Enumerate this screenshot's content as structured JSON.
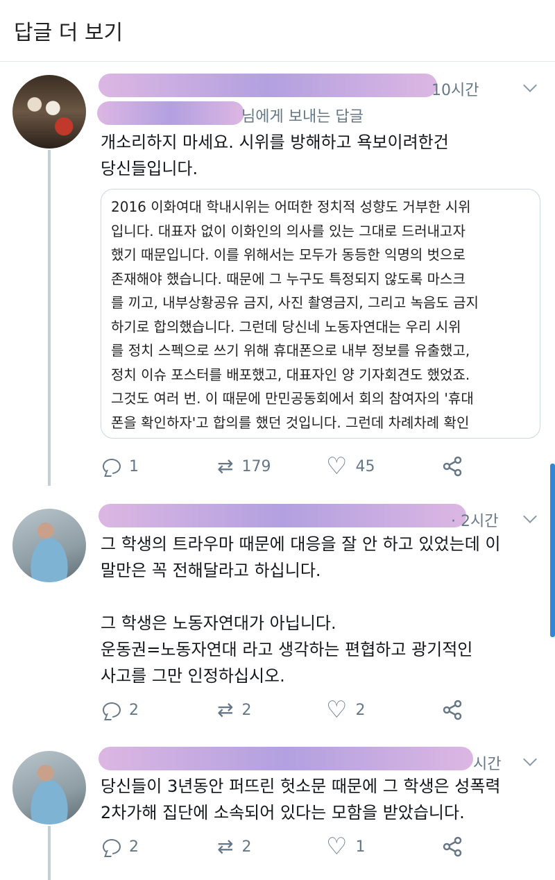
{
  "header": {
    "title": "답글 더 보기"
  },
  "tweets": [
    {
      "time": "10시간",
      "reply_to_suffix": "님에게 보내는 답글",
      "text": "개소리하지 마세요. 시위를 방해하고 욕보이려한건\n당신들입니다.",
      "quote_lines": [
        "2016 이화여대 학내시위는 어떠한 정치적 성향도 거부한 시위",
        "입니다. 대표자 없이 이화인의 의사를 있는 그대로 드러내고자",
        "했기 때문입니다. 이를 위해서는 모두가 동등한 익명의 벗으로",
        "존재해야 했습니다. 때문에 그 누구도 특정되지 않도록 마스크",
        "를 끼고, 내부상황공유 금지, 사진 촬영금지, 그리고 녹음도 금지",
        "하기로 합의했습니다. 그런데 당신네 노동자연대는 우리 시위",
        "를 정치 스펙으로 쓰기 위해 휴대폰으로 내부 정보를 유출했고,",
        "정치 이슈 포스터를 배포했고, 대표자인 양 기자회견도 했었죠.",
        "그것도 여러 번. 이 때문에 만민공동회에서 회의 참여자의 '휴대",
        "폰을 확인하자'고 합의를 했던 것입니다. 그런데 차례차례 확인"
      ],
      "replies": "1",
      "retweets": "179",
      "likes": "45"
    },
    {
      "time": "· 2시간",
      "text": "그 학생의 트라우마 때문에 대응을 잘 안 하고 있었는데 이\n말만은 꼭 전해달라고 하십니다.\n\n그 학생은 노동자연대가 아닙니다.\n운동권=노동자연대 라고 생각하는 편협하고 광기적인\n사고를 그만 인정하십시오.",
      "replies": "2",
      "retweets": "2",
      "likes": "2"
    },
    {
      "time": "시간",
      "text": "당신들이 3년동안 퍼뜨린 헛소문 때문에 그 학생은 성폭력\n2차가해 집단에 소속되어 있다는 모함을 받았습니다.",
      "replies": "2",
      "retweets": "2",
      "likes": "1"
    }
  ]
}
